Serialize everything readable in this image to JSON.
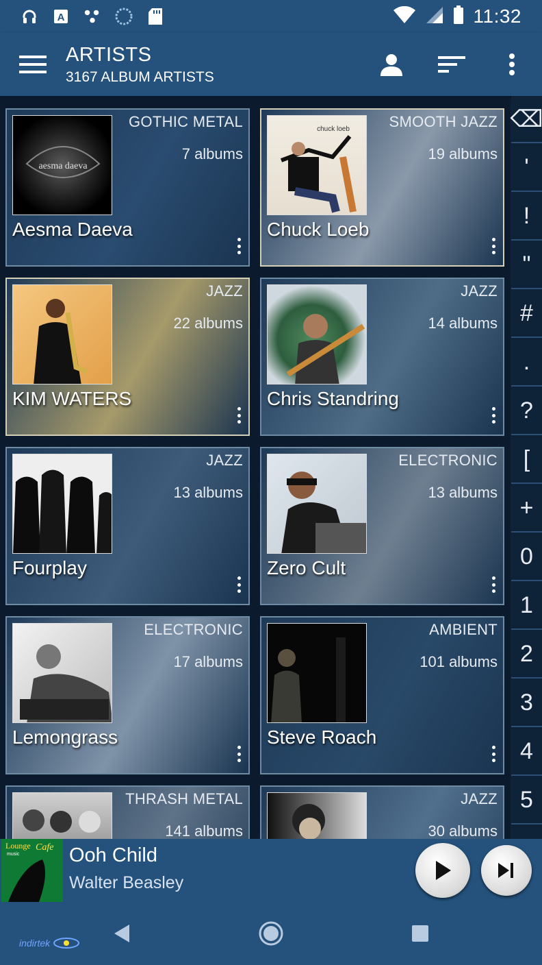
{
  "status_bar": {
    "time": "11:32",
    "left_icons": [
      "headset-icon",
      "font-a-icon",
      "share-icon",
      "sync-icon",
      "sd-card-icon"
    ],
    "right_icons": [
      "wifi-icon",
      "signal-icon",
      "battery-icon"
    ]
  },
  "app_bar": {
    "title": "ARTISTS",
    "subtitle": "3167 ALBUM ARTISTS",
    "actions": [
      "person-icon",
      "sort-icon",
      "overflow-menu-icon"
    ]
  },
  "artists": [
    {
      "name": "Aesma Daeva",
      "genre": "GOTHIC METAL",
      "albums": "7 albums",
      "tint": "#2a4c70"
    },
    {
      "name": "Chuck Loeb",
      "genre": "SMOOTH JAZZ",
      "albums": "19 albums",
      "tint": "#8a99aa"
    },
    {
      "name": "KIM WATERS",
      "genre": "JAZZ",
      "albums": "22 albums",
      "tint": "#a69a6a"
    },
    {
      "name": "Chris Standring",
      "genre": "JAZZ",
      "albums": "14 albums",
      "tint": "#4f6d87"
    },
    {
      "name": "Fourplay",
      "genre": "JAZZ",
      "albums": "13 albums",
      "tint": "#3e5c7a"
    },
    {
      "name": "Zero Cult",
      "genre": "ELECTRONIC",
      "albums": "13 albums",
      "tint": "#6e7f90"
    },
    {
      "name": "Lemongrass",
      "genre": "ELECTRONIC",
      "albums": "17 albums",
      "tint": "#7f93a8"
    },
    {
      "name": "Steve Roach",
      "genre": "AMBIENT",
      "albums": "101 albums",
      "tint": "#294968"
    },
    {
      "name": "",
      "genre": "THRASH METAL",
      "albums": "141 albums",
      "tint": "#5f7388"
    },
    {
      "name": "",
      "genre": "JAZZ",
      "albums": "30 albums",
      "tint": "#51708d"
    }
  ],
  "album_art_text": {
    "aesma": "aesma daeva",
    "chuck": "chuck loeb"
  },
  "index": [
    "⌫",
    "'",
    "!",
    "\"",
    "#",
    ".",
    "?",
    "[",
    "+",
    "0",
    "1",
    "2",
    "3",
    "4",
    "5"
  ],
  "now_playing": {
    "title": "Ooh Child",
    "artist": "Walter Beasley",
    "art_text_1": "Lounge",
    "art_text_2": "Cafe",
    "art_text_3": "music"
  },
  "watermark": "indirtek"
}
